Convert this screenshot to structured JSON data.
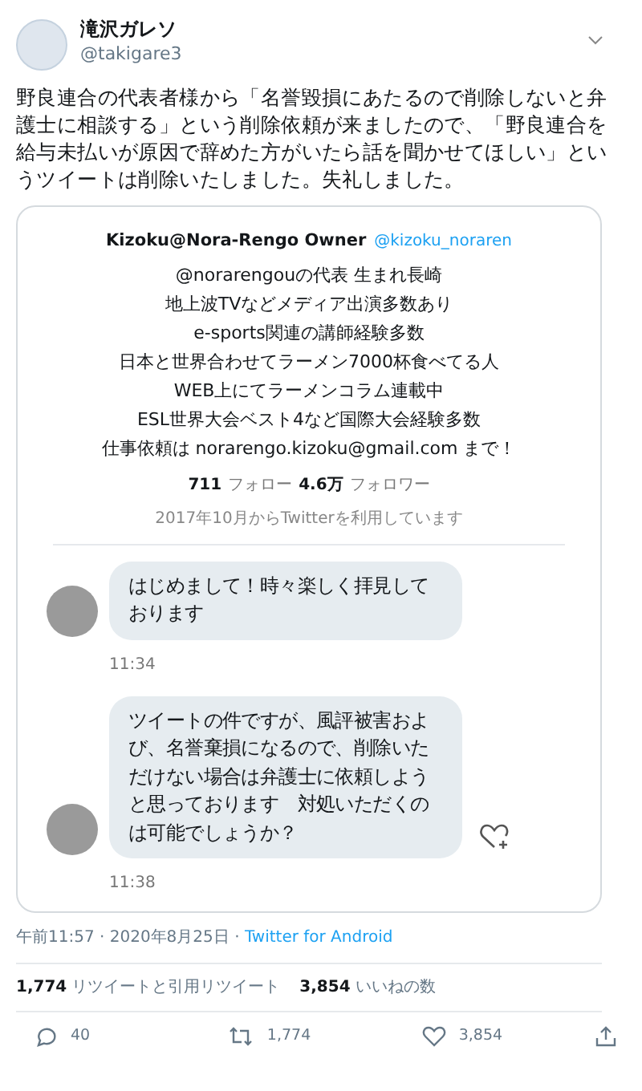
{
  "author": {
    "name": "滝沢ガレソ",
    "handle": "@takigare3"
  },
  "tweet_text": "野良連合の代表者様から「名誉毀損にあたるので削除しないと弁護士に相談する」という削除依頼が来ましたので、「野良連合を給与未払いが原因で辞めた方がいたら話を聞かせてほしい」というツイートは削除いたしました。失礼しました。",
  "embedded": {
    "profile": {
      "name": "Kizoku@Nora-Rengo Owner",
      "handle": "@kizoku_noraren",
      "bio_lines": [
        "@norarengouの代表 生まれ長崎",
        "地上波TVなどメディア出演多数あり",
        "e-sports関連の講師経験多数",
        "日本と世界合わせてラーメン7000杯食べてる人",
        "WEB上にてラーメンコラム連載中",
        "ESL世界大会ベスト4など国際大会経験多数",
        "仕事依頼は norarengo.kizoku@gmail.com まで！"
      ],
      "following_count": "711",
      "following_label": "フォロー",
      "followers_count": "4.6万",
      "followers_label": "フォロワー",
      "joined": "2017年10月からTwitterを利用しています"
    },
    "messages": [
      {
        "text": "はじめまして！時々楽しく拝見しております",
        "time": "11:34",
        "like_button": false
      },
      {
        "text": "ツイートの件ですが、風評被害および、名誉棄損になるので、削除いただけない場合は弁護士に依頼しようと思っております　対処いただくのは可能でしょうか？",
        "time": "11:38",
        "like_button": true
      }
    ]
  },
  "meta": {
    "time": "午前11:57 · 2020年8月25日 · ",
    "source": "Twitter for Android"
  },
  "stats": [
    {
      "count": "1,774",
      "label": "リツイートと引用リツイート"
    },
    {
      "count": "3,854",
      "label": "いいねの数"
    }
  ],
  "actions": [
    {
      "kind": "reply",
      "count": "40"
    },
    {
      "kind": "retweet",
      "count": "1,774"
    },
    {
      "kind": "like",
      "count": "3,854"
    },
    {
      "kind": "share"
    }
  ]
}
